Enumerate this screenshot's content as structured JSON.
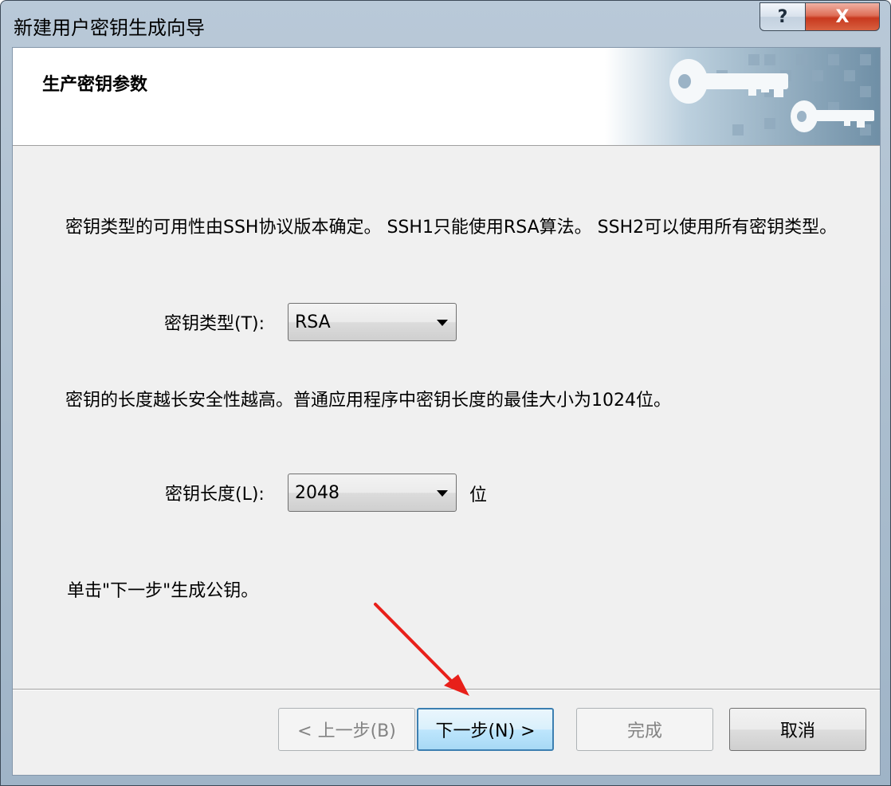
{
  "window": {
    "title": "新建用户密钥生成向导",
    "help_label": "?",
    "close_label": "X"
  },
  "banner": {
    "title": "生产密钥参数",
    "art_icon": "key-pair-icon"
  },
  "content": {
    "description": "密钥类型的可用性由SSH协议版本确定。 SSH1只能使用RSA算法。 SSH2可以使用所有密钥类型。",
    "key_type": {
      "label": "密钥类型(T):",
      "value": "RSA"
    },
    "length_hint": "密钥的长度越长安全性越高。普通应用程序中密钥长度的最佳大小为1024位。",
    "key_length": {
      "label": "密钥长度(L):",
      "value": "2048",
      "unit": "位"
    },
    "instruction": "单击\"下一步\"生成公钥。"
  },
  "buttons": {
    "back": "< 上一步(B)",
    "next": "下一步(N) >",
    "finish": "完成",
    "cancel": "取消"
  },
  "colors": {
    "annotation_arrow": "#e8201a",
    "default_button_border": "#3c7fb1"
  }
}
